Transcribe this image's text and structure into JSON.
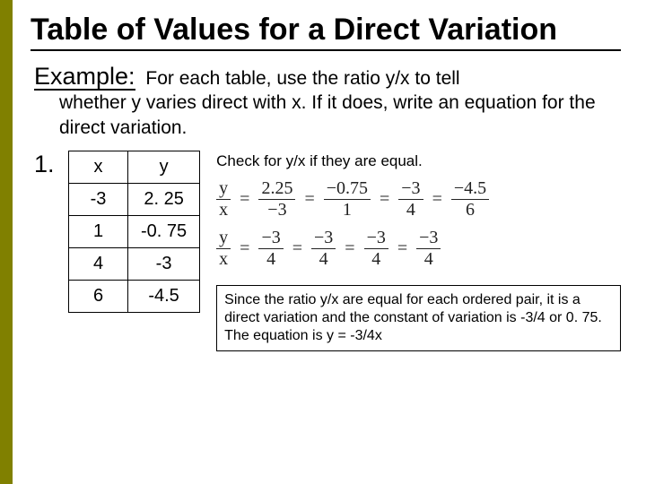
{
  "title": "Table of Values for a Direct Variation",
  "example": {
    "label": "Example:",
    "text_first": "For each table, use the ratio y/x to tell",
    "text_rest": "whether y varies direct with x.  If it does, write an equation for the direct variation."
  },
  "problem_number": "1.",
  "table": {
    "head_x": "x",
    "head_y": "y",
    "rows": [
      {
        "x": "-3",
        "y": "2. 25"
      },
      {
        "x": "1",
        "y": "-0. 75"
      },
      {
        "x": "4",
        "y": "-3"
      },
      {
        "x": "6",
        "y": "-4.5"
      }
    ]
  },
  "check_text": "Check for y/x if they are equal.",
  "equations": {
    "row1": {
      "lhs_num": "y",
      "lhs_den": "x",
      "f1_num": "2.25",
      "f1_den": "−3",
      "f2_num": "−0.75",
      "f2_den": "1",
      "f3_num": "−3",
      "f3_den": "4",
      "f4_num": "−4.5",
      "f4_den": "6"
    },
    "row2": {
      "lhs_num": "y",
      "lhs_den": "x",
      "f1_num": "−3",
      "f1_den": "4",
      "f2_num": "−3",
      "f2_den": "4",
      "f3_num": "−3",
      "f3_den": "4",
      "f4_num": "−3",
      "f4_den": "4"
    }
  },
  "conclusion": "Since the ratio y/x are equal for each ordered pair, it is a direct variation and the constant of variation is -3/4 or 0. 75.  The equation is y = -3/4x"
}
